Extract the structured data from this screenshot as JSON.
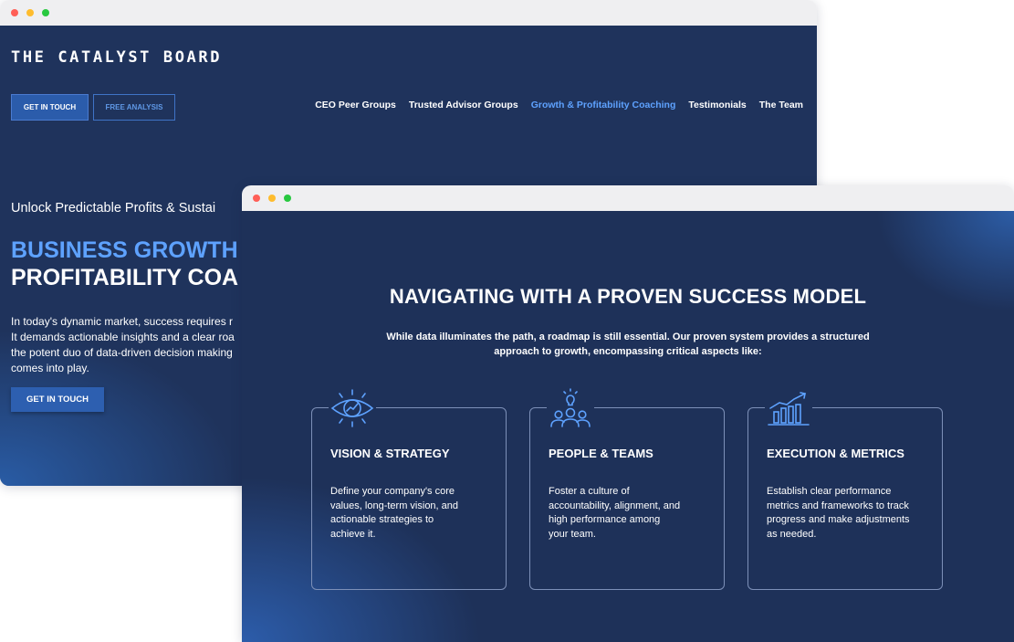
{
  "site": {
    "logo": "THE CATALYST BOARD",
    "buttons": {
      "get_in_touch": "GET IN TOUCH",
      "free_analysis": "FREE ANALYSIS"
    },
    "nav": [
      {
        "label": "CEO Peer Groups",
        "active": false
      },
      {
        "label": "Trusted Advisor Groups",
        "active": false
      },
      {
        "label": "Growth & Profitability Coaching",
        "active": true
      },
      {
        "label": "Testimonials",
        "active": false
      },
      {
        "label": "The Team",
        "active": false
      }
    ],
    "hero": {
      "subtitle": "Unlock Predictable Profits & Sustai",
      "title_line1": "BUSINESS GROWTH",
      "title_line2": "PROFITABILITY COA",
      "body_lines": [
        "In today's dynamic market, success requires r",
        "It demands actionable insights and a clear roa",
        "the potent duo of data-driven decision making",
        "comes into play."
      ],
      "cta": "GET IN TOUCH"
    }
  },
  "section": {
    "title": "NAVIGATING WITH A PROVEN SUCCESS MODEL",
    "subtitle_lines": [
      "While data illuminates the path, a roadmap is still essential. Our proven system provides a structured",
      "approach to growth, encompassing critical aspects like:"
    ],
    "cards": [
      {
        "icon": "eye-chart-icon",
        "title": "VISION & STRATEGY",
        "desc_lines": [
          "Define your company's core",
          "values, long-term vision, and",
          "actionable strategies to",
          "achieve it."
        ]
      },
      {
        "icon": "team-lightbulb-icon",
        "title": "PEOPLE & TEAMS",
        "desc_lines": [
          "Foster a culture of",
          "accountability, alignment, and",
          "high performance among",
          "your team."
        ]
      },
      {
        "icon": "bar-chart-growth-icon",
        "title": "EXECUTION & METRICS",
        "desc_lines": [
          "Establish clear performance",
          "metrics and frameworks to track",
          "progress and make adjustments",
          "as needed."
        ]
      }
    ]
  },
  "colors": {
    "navy": "#1e3159",
    "accent_blue": "#5ea2ff",
    "button_blue": "#2b5cab"
  }
}
